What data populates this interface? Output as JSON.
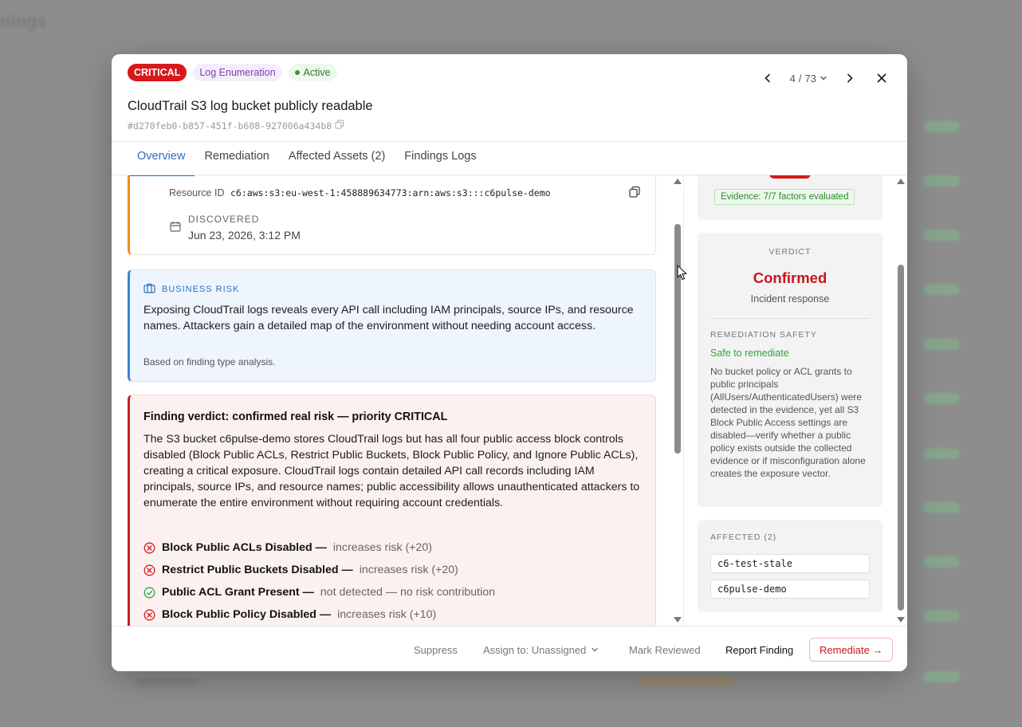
{
  "background": {
    "title": "nings"
  },
  "header": {
    "badges": {
      "severity": "CRITICAL",
      "category": "Log Enumeration",
      "status": "Active"
    },
    "title": "CloudTrail S3 log bucket publicly readable",
    "finding_id": "#d270feb0-b857-451f-b608-927006a434b8",
    "pager": {
      "current": "4",
      "separator": "/",
      "total": "73"
    }
  },
  "tabs": [
    {
      "label": "Overview",
      "active": true
    },
    {
      "label": "Remediation"
    },
    {
      "label": "Affected Assets (2)"
    },
    {
      "label": "Findings Logs"
    }
  ],
  "resource": {
    "id_label": "Resource ID",
    "id_value": "c6:aws:s3:eu-west-1:458889634773:arn:aws:s3:::c6pulse-demo",
    "discovered_label": "DISCOVERED",
    "discovered_value": "Jun 23, 2026, 3:12 PM"
  },
  "business_risk": {
    "heading": "BUSINESS RISK",
    "text": "Exposing CloudTrail logs reveals every API call including IAM principals, source IPs, and resource names. Attackers gain a detailed map of the environment without needing account access.",
    "note": "Based on finding type analysis."
  },
  "verdict_card": {
    "title": "Finding verdict: confirmed real risk — priority CRITICAL",
    "text": "The S3 bucket c6pulse-demo stores CloudTrail logs but has all four public access block controls disabled (Block Public ACLs, Restrict Public Buckets, Block Public Policy, and Ignore Public ACLs), creating a critical exposure. CloudTrail logs contain detailed API call records including IAM principals, source IPs, and resource names; public accessibility allows unauthenticated attackers to enumerate the entire environment without requiring account credentials.",
    "factors": [
      {
        "name": "Block Public ACLs Disabled —",
        "effect": "increases risk (+20)",
        "status": "risk"
      },
      {
        "name": "Restrict Public Buckets Disabled —",
        "effect": "increases risk (+20)",
        "status": "risk"
      },
      {
        "name": "Public ACL Grant Present —",
        "effect": "not detected — no risk contribution",
        "status": "ok"
      },
      {
        "name": "Block Public Policy Disabled —",
        "effect": "increases risk (+10)",
        "status": "risk"
      }
    ]
  },
  "side": {
    "evidence": "Evidence: 7/7 factors evaluated",
    "verdict_label": "VERDICT",
    "verdict": "Confirmed",
    "verdict_sub": "Incident response",
    "safety_label": "REMEDIATION SAFETY",
    "safety_value": "Safe to remediate",
    "safety_text": "No bucket policy or ACL grants to public principals (AllUsers/AuthenticatedUsers) were detected in the evidence, yet all S3 Block Public Access settings are disabled—verify whether a public policy exists outside the collected evidence or if misconfiguration alone creates the exposure vector.",
    "affected_label": "AFFECTED (2)",
    "affected": [
      "c6-test-stale",
      "c6pulse-demo"
    ]
  },
  "footer": {
    "suppress": "Suppress",
    "assign": "Assign to: Unassigned",
    "mark_reviewed": "Mark Reviewed",
    "report": "Report Finding",
    "remediate": "Remediate →"
  },
  "colors": {
    "critical": "#d7191c",
    "accent": "#2f6fc4",
    "success": "#2fa53c",
    "warning": "#f28b1e"
  }
}
